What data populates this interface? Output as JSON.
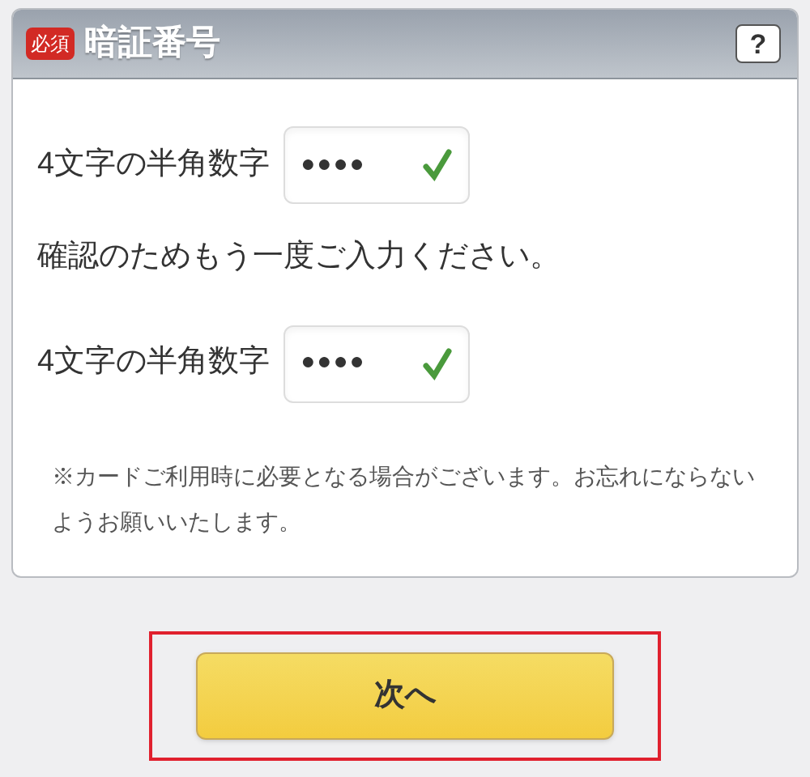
{
  "panel": {
    "badge": "必須",
    "title": "暗証番号",
    "help": "?"
  },
  "rows": [
    {
      "kind": "field",
      "label": "4文字の半角数字",
      "value": "●●●●",
      "valid": true
    },
    {
      "kind": "text",
      "text": "確認のためもう一度ご入力ください。"
    },
    {
      "kind": "field",
      "label": "4文字の半角数字",
      "value": "●●●●",
      "valid": true
    }
  ],
  "note": "※カードご利用時に必要となる場合がございます。お忘れにならないようお願いいたします。",
  "next_button": {
    "label": "次へ",
    "highlighted": true
  }
}
